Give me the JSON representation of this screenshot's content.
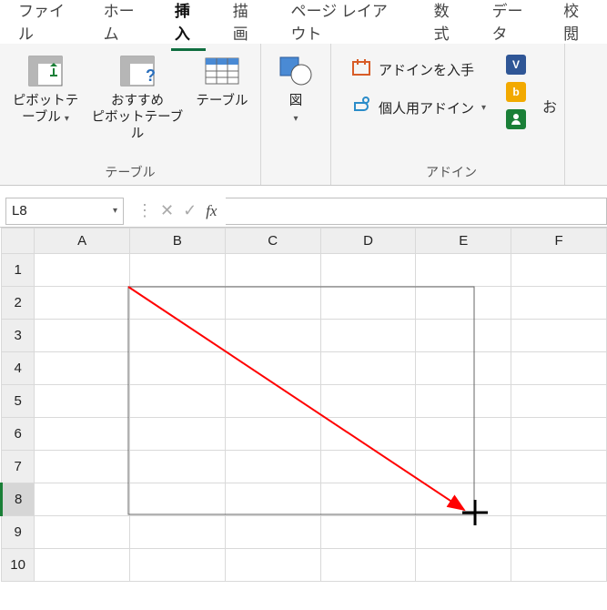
{
  "tabs": {
    "file": "ファイル",
    "home": "ホーム",
    "insert": "挿入",
    "draw": "描画",
    "pagelayout": "ページ レイアウト",
    "formulas": "数式",
    "data": "データ",
    "review": "校閲"
  },
  "ribbon": {
    "tables_group": "テーブル",
    "pivot": "ピボットテーブル",
    "recommended_pivot_l1": "おすすめ",
    "recommended_pivot_l2": "ピボットテーブル",
    "table": "テーブル",
    "illustrations_btn": "図",
    "addins_group": "アドイン",
    "get_addins": "アドインを入手",
    "my_addins": "個人用アドイン",
    "office_addins_hint": "お"
  },
  "formula_bar": {
    "namebox": "L8",
    "fx": "fx",
    "value": ""
  },
  "grid": {
    "cols": [
      "A",
      "B",
      "C",
      "D",
      "E",
      "F"
    ],
    "rows": [
      "1",
      "2",
      "3",
      "4",
      "5",
      "6",
      "7",
      "8",
      "9",
      "10"
    ],
    "selected_row": "8"
  }
}
